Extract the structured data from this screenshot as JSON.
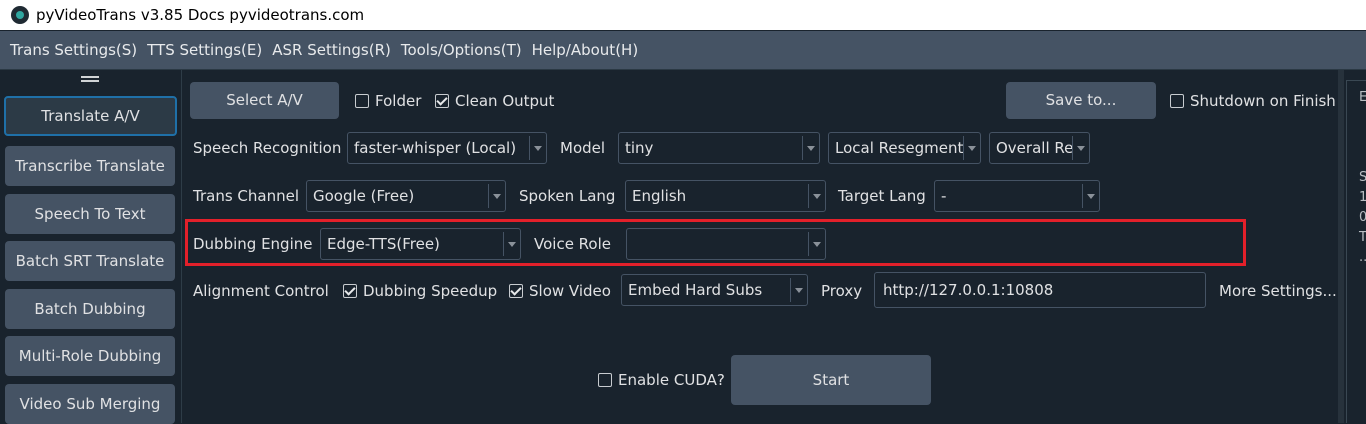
{
  "window": {
    "title": "pyVideoTrans v3.85 Docs pyvideotrans.com"
  },
  "menu": [
    "Trans Settings(S)",
    "TTS Settings(E)",
    "ASR Settings(R)",
    "Tools/Options(T)",
    "Help/About(H)"
  ],
  "sidebar": {
    "items": [
      {
        "label": "Translate A/V",
        "active": true
      },
      {
        "label": "Transcribe Translate"
      },
      {
        "label": "Speech To Text"
      },
      {
        "label": "Batch SRT Translate"
      },
      {
        "label": "Batch Dubbing"
      },
      {
        "label": "Multi-Role Dubbing"
      },
      {
        "label": "Video Sub Merging"
      }
    ]
  },
  "row1": {
    "select_btn": "Select A/V",
    "folder": {
      "label": "Folder",
      "checked": false
    },
    "clean_output": {
      "label": "Clean Output",
      "checked": true
    },
    "save_btn": "Save to...",
    "shutdown": {
      "label": "Shutdown on Finish",
      "checked": false
    }
  },
  "row2": {
    "speech_label": "Speech Recognition",
    "speech_value": "faster-whisper (Local)",
    "model_label": "Model",
    "model_value": "tiny",
    "resegment_value": "Local Resegment",
    "overall_value": "Overall Re"
  },
  "row3": {
    "channel_label": "Trans Channel",
    "channel_value": "Google (Free)",
    "spoken_label": "Spoken Lang",
    "spoken_value": "English",
    "target_label": "Target Lang",
    "target_value": "-"
  },
  "row4": {
    "engine_label": "Dubbing Engine",
    "engine_value": "Edge-TTS(Free)",
    "voice_label": "Voice Role",
    "voice_value": ""
  },
  "row5": {
    "align_label": "Alignment Control",
    "speedup": {
      "label": "Dubbing Speedup",
      "checked": true
    },
    "slow": {
      "label": "Slow Video",
      "checked": true
    },
    "subs_value": "Embed Hard Subs",
    "proxy_label": "Proxy",
    "proxy_value": "http://127.0.0.1:10808",
    "more": "More Settings..."
  },
  "row6": {
    "cuda": {
      "label": "Enable CUDA?",
      "checked": false
    },
    "start_btn": "Start"
  },
  "right_panel": {
    "lines": [
      "E",
      "S",
      "1",
      "0",
      "T",
      "..."
    ]
  },
  "colors": {
    "highlight": "#e3202a",
    "button": "#455364",
    "background": "#19232d"
  }
}
